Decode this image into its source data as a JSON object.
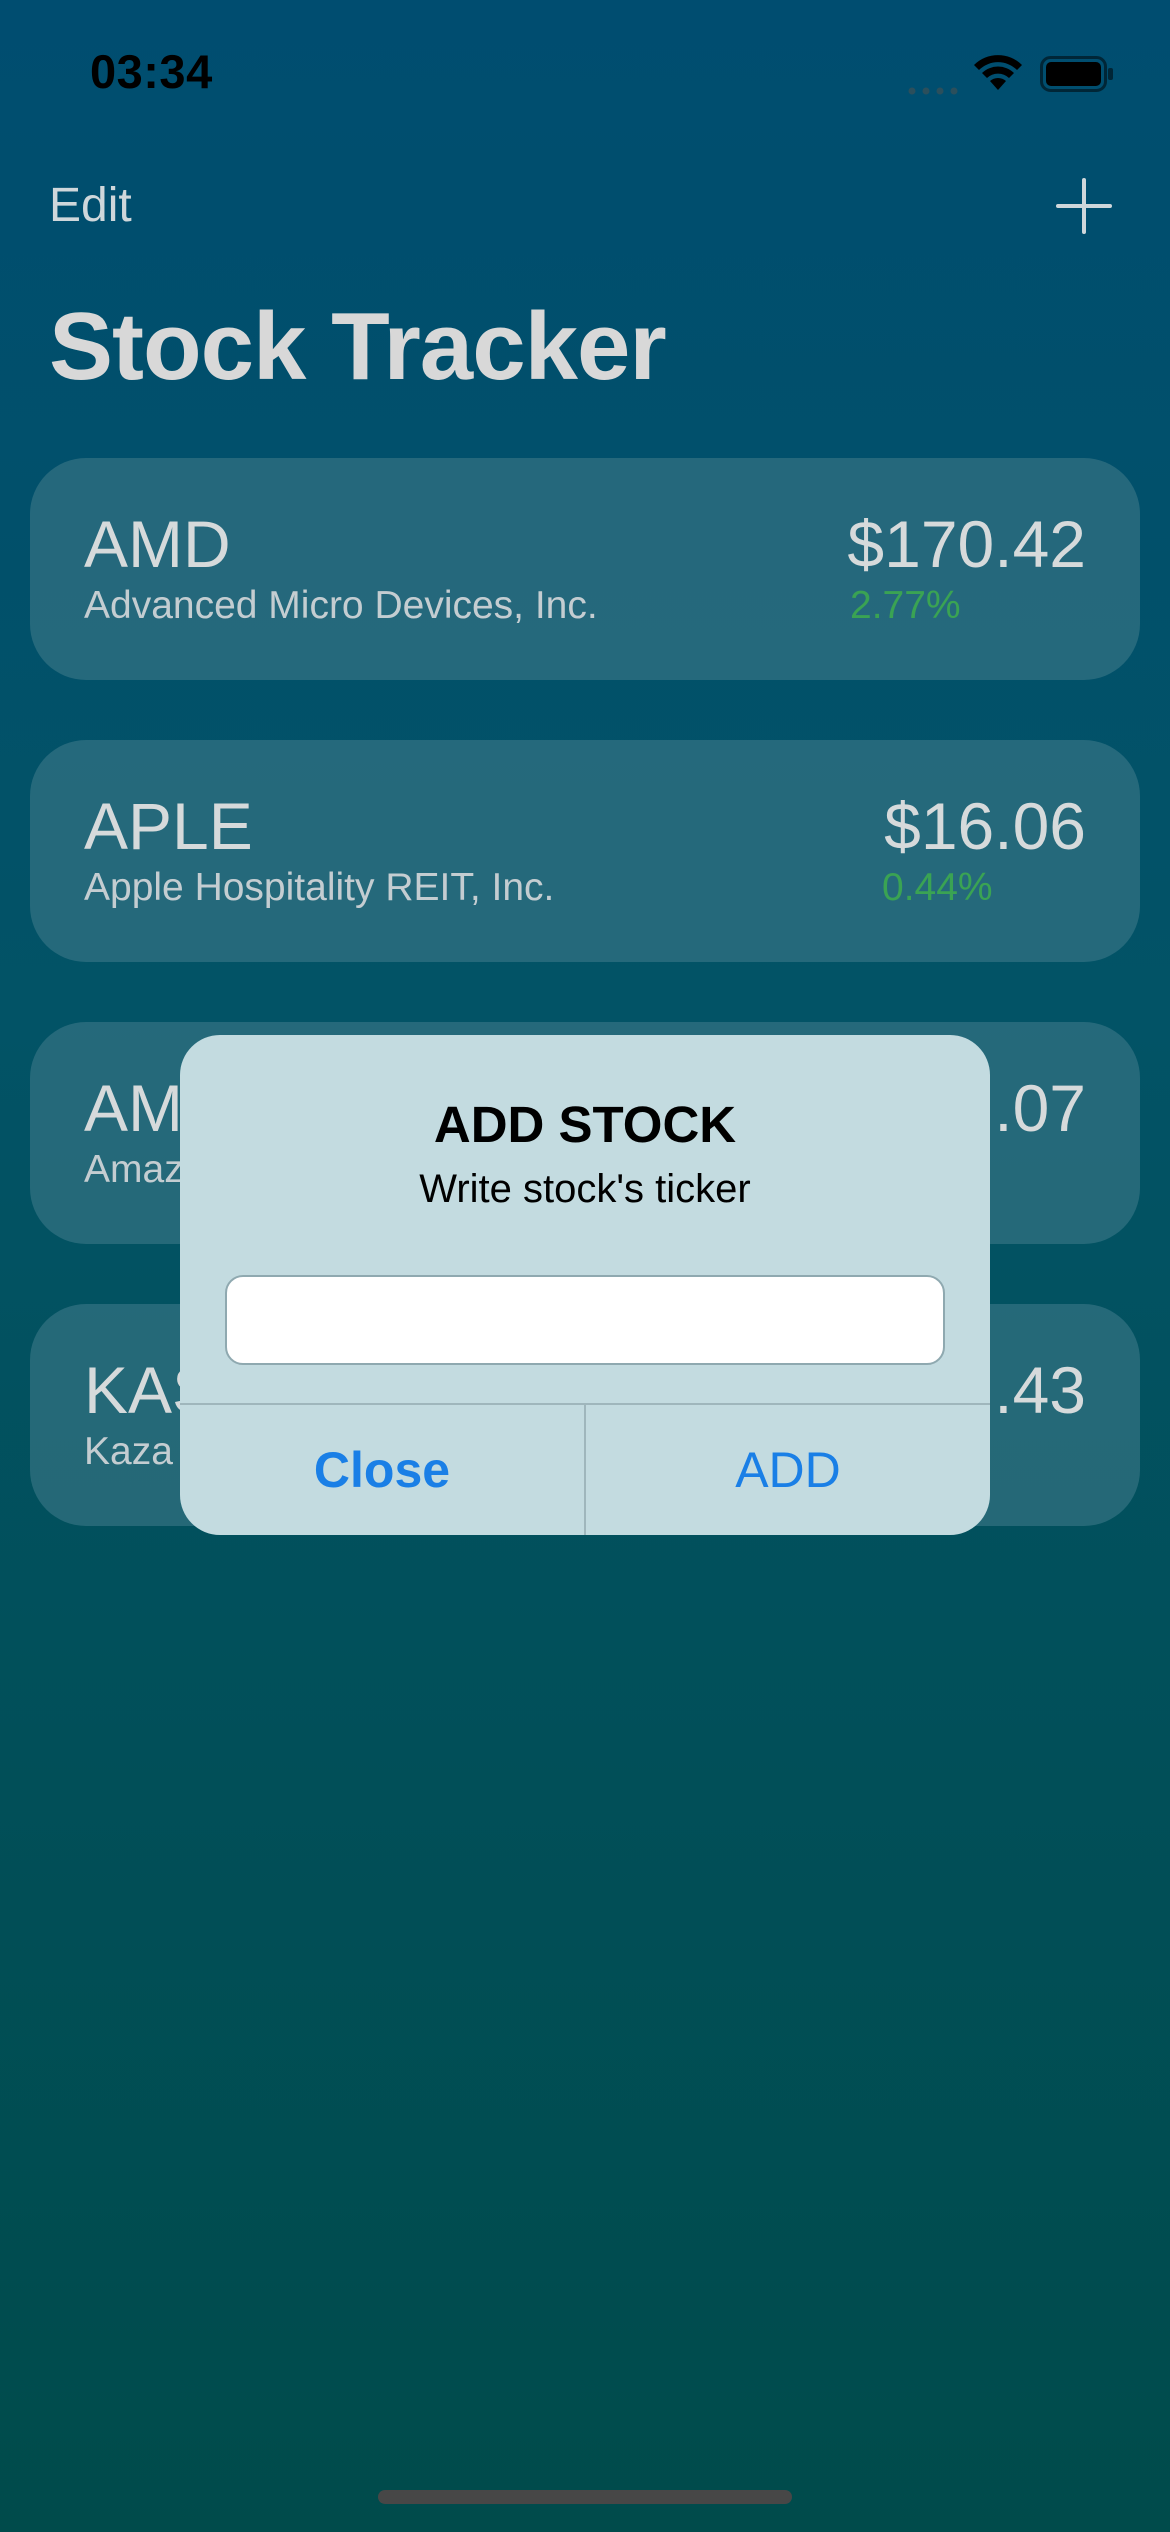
{
  "status_bar": {
    "time": "03:34",
    "icons": [
      "signal-dots-icon",
      "wifi-icon",
      "battery-icon"
    ]
  },
  "nav": {
    "edit_label": "Edit",
    "add_icon": "plus-icon",
    "title": "Stock Tracker"
  },
  "stocks": [
    {
      "ticker": "AMD",
      "name": "Advanced Micro Devices, Inc.",
      "price": "$170.42",
      "change": "2.77%"
    },
    {
      "ticker": "APLE",
      "name": "Apple Hospitality REIT, Inc.",
      "price": "$16.06",
      "change": "0.44%"
    },
    {
      "ticker": "AM",
      "name": "Amaz",
      "price": ".07",
      "change": ""
    },
    {
      "ticker": "KAS",
      "name": "Kaza",
      "price": ".43",
      "change": ""
    }
  ],
  "alert": {
    "title": "ADD STOCK",
    "message": "Write stock's ticker",
    "input_value": "",
    "close_label": "Close",
    "add_label": "ADD"
  },
  "colors": {
    "positive_change": "#3aa353",
    "action_blue": "#1a7fe6",
    "alert_bg": "#c3dbe0"
  }
}
